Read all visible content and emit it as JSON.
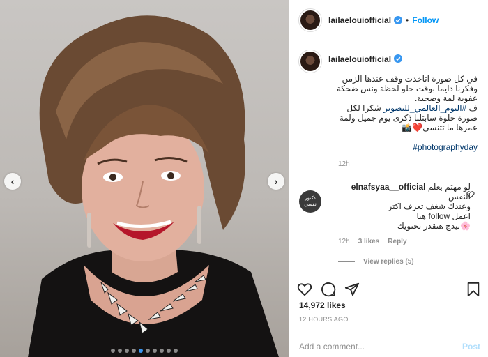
{
  "post": {
    "username": "lailaelouiofficial",
    "follow_label": "Follow",
    "separator": "•",
    "verified_color": "#3897f0",
    "accent_color": "#0095f6"
  },
  "caption": {
    "username": "lailaelouiofficial",
    "text_main": "في كل صورة اتاخدت وقف عندها الزمن وفكرنا دايما بوقت حلو لحظة ونس ضحكة عفوية لمة وصحبة.",
    "text_hashtag_prefix": "ف ",
    "hashtag_ar": "#اليوم_العالمي_للتصوير",
    "text_after": " شكرا لكل صورة حلوة سابتلنا ذكرى يوم جميل ولمة عمرها ما تتنسي❤️📸",
    "hashtag_en": "#photographyday",
    "time": "12h"
  },
  "comment": {
    "avatar_text": "دكتور نفسي",
    "username": "elnafsyaa__official",
    "text": "لو مهتم بعلم النفس\nوعندك شغف تعرف اكتر\nاعمل follow هنا\n🌸بيدج هتقدر تحتويك",
    "time": "12h",
    "likes": "3 likes",
    "reply_label": "Reply",
    "view_replies": "View replies (5)"
  },
  "actions": {
    "like_icon": "heart-icon",
    "comment_icon": "comment-icon",
    "share_icon": "share-icon",
    "save_icon": "bookmark-icon"
  },
  "likes": "14,972 likes",
  "posted_ago": "12 HOURS AGO",
  "add_comment": {
    "placeholder": "Add a comment...",
    "post_label": "Post"
  },
  "carousel": {
    "slide_count": 10,
    "active_index": 4
  }
}
